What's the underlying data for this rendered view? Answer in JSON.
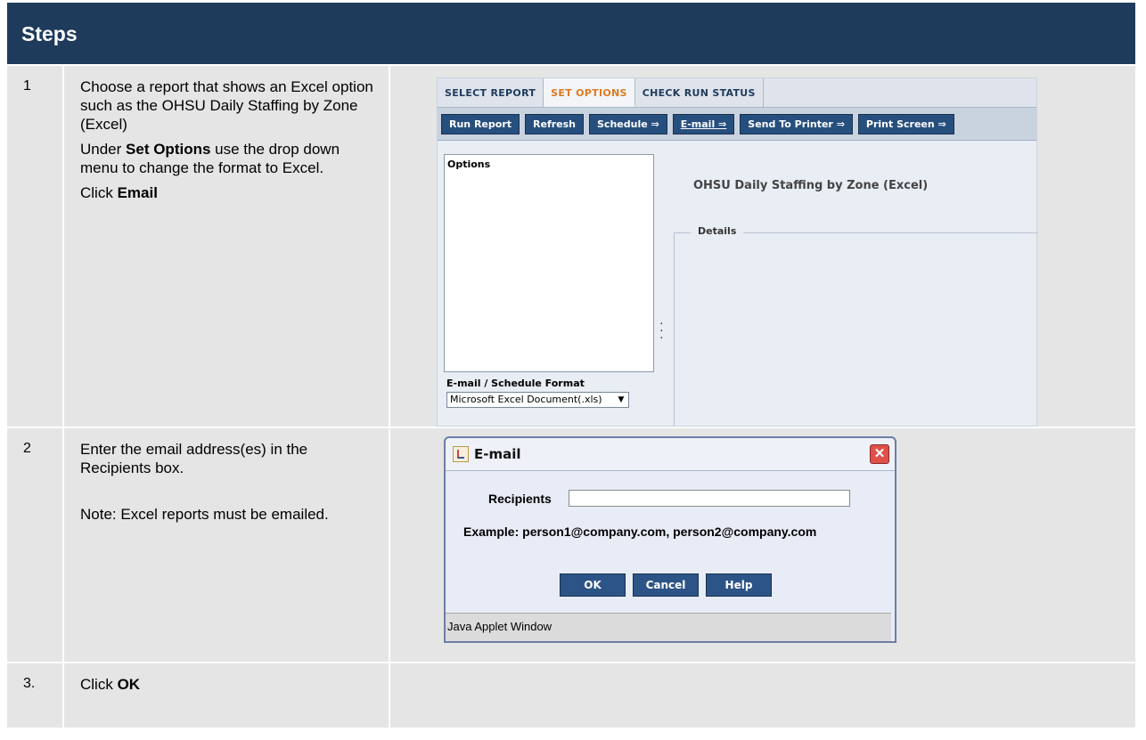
{
  "header": {
    "title": "Steps"
  },
  "steps": [
    {
      "number": "1",
      "line1": "Choose a report that shows an Excel option such as the OHSU Daily Staffing by Zone (Excel)",
      "line2_pre": "Under ",
      "line2_bold": "Set Options",
      "line2_post": " use the drop down menu to change the format to Excel.",
      "line3_pre": "Click ",
      "line3_bold": "Email"
    },
    {
      "number": "2",
      "line1": "Enter the email address(es) in the Recipients box.",
      "line2": "Note: Excel reports must be emailed."
    },
    {
      "number": "3.",
      "line1_pre": "Click ",
      "line1_bold": "OK"
    }
  ],
  "report_screen": {
    "tabs": [
      "SELECT REPORT",
      "SET OPTIONS",
      "CHECK RUN STATUS"
    ],
    "active_tab": "SET OPTIONS",
    "buttons": [
      "Run Report",
      "Refresh",
      "Schedule ⇒",
      "E-mail ⇒",
      "Send To Printer ⇒",
      "Print Screen ⇒"
    ],
    "options_label": "Options",
    "report_title": "OHSU Daily Staffing by Zone (Excel)",
    "details_label": "Details",
    "format_label": "E-mail / Schedule Format",
    "format_value": "Microsoft Excel Document(.xls)"
  },
  "email_dialog": {
    "title": "E-mail",
    "recipients_label": "Recipients",
    "recipients_value": "",
    "example": "Example: person1@company.com, person2@company.com",
    "ok": "OK",
    "cancel": "Cancel",
    "help": "Help",
    "status": "Java Applet Window"
  }
}
